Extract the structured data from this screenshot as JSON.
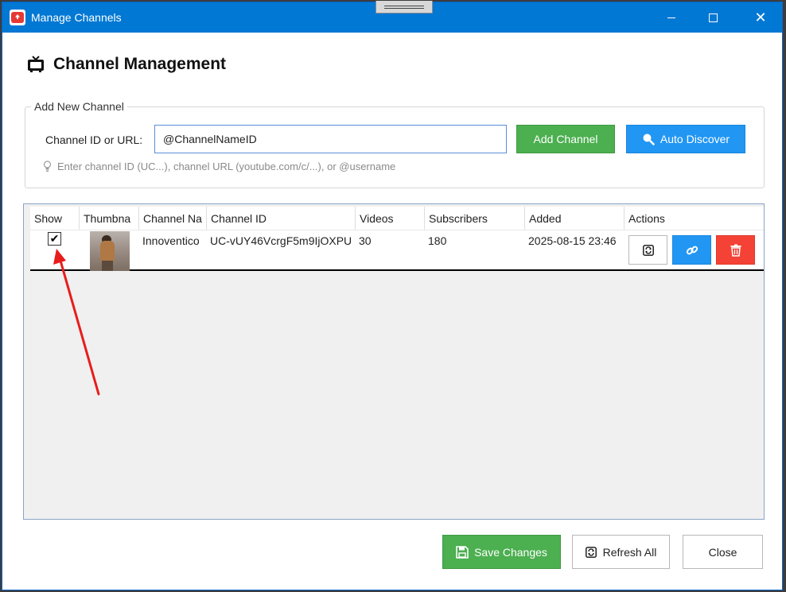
{
  "window": {
    "title": "Manage Channels",
    "controls": {
      "minimize": "minimize-icon",
      "maximize": "maximize-icon",
      "close": "close-icon"
    }
  },
  "heading": {
    "icon": "tv-icon",
    "text": "Channel Management"
  },
  "add_group": {
    "legend": "Add New Channel",
    "input_label": "Channel ID or URL:",
    "input_value": "@ChannelNameID",
    "add_button": "Add Channel",
    "discover_button": "Auto Discover",
    "hint": "Enter channel ID (UC...), channel URL (youtube.com/c/...), or @username"
  },
  "grid": {
    "columns": [
      "Show",
      "Thumbna",
      "Channel Na",
      "Channel ID",
      "Videos",
      "Subscribers",
      "Added",
      "Actions"
    ],
    "rows": [
      {
        "show": true,
        "channel_name": "Innoventico",
        "channel_id": "UC-vUY46VcrgF5m9IjOXPU",
        "videos": "30",
        "subscribers": "180",
        "added": "2025-08-15 23:46"
      }
    ]
  },
  "footer": {
    "save": "Save Changes",
    "refresh_all": "Refresh All",
    "close": "Close"
  },
  "colors": {
    "titlebar": "#0078d4",
    "green": "#4caf50",
    "blue": "#2196f3",
    "red": "#f44336",
    "annotation_arrow": "#e81c1c"
  }
}
